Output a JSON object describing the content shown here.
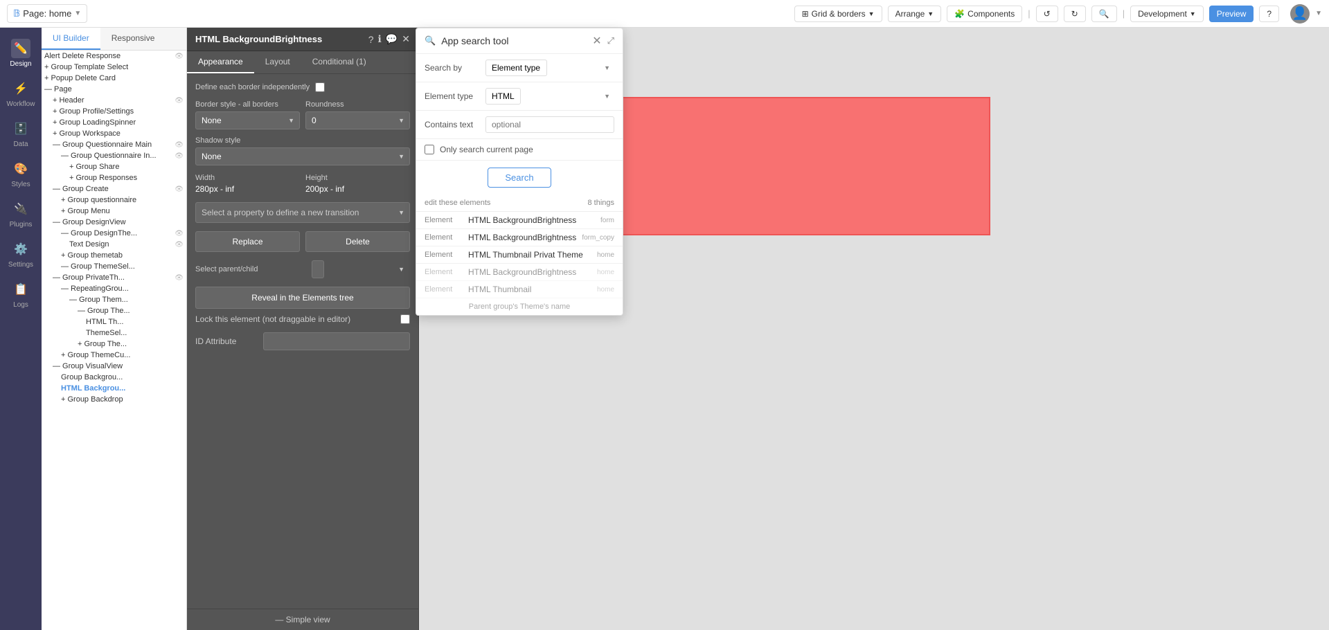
{
  "topbar": {
    "page_label": "Page: home",
    "grid_borders": "Grid & borders",
    "arrange": "Arrange",
    "components": "Components",
    "development": "Development",
    "preview_label": "Preview",
    "help_label": "?"
  },
  "sidebar": {
    "items": [
      {
        "id": "design",
        "label": "Design",
        "icon": "✏️"
      },
      {
        "id": "workflow",
        "label": "Workflow",
        "icon": "⚡"
      },
      {
        "id": "data",
        "label": "Data",
        "icon": "🗄️"
      },
      {
        "id": "styles",
        "label": "Styles",
        "icon": "🎨"
      },
      {
        "id": "plugins",
        "label": "Plugins",
        "icon": "🔌"
      },
      {
        "id": "settings",
        "label": "Settings",
        "icon": "⚙️"
      },
      {
        "id": "logs",
        "label": "Logs",
        "icon": "📋"
      }
    ]
  },
  "elements_panel": {
    "tabs": [
      "UI Builder",
      "Responsive"
    ],
    "tree_items": [
      {
        "label": "Alert Delete Response",
        "indent": 0,
        "has_eye": true
      },
      {
        "label": "+ Group Template Select",
        "indent": 0
      },
      {
        "label": "+ Popup Delete Card",
        "indent": 0
      },
      {
        "label": "— Page",
        "indent": 0
      },
      {
        "label": "+ Header",
        "indent": 1,
        "has_eye": true
      },
      {
        "label": "+ Group Profile/Settings",
        "indent": 1
      },
      {
        "label": "+ Group LoadingSpinner",
        "indent": 1
      },
      {
        "label": "+ Group Workspace",
        "indent": 1
      },
      {
        "label": "— Group Questionnaire Main",
        "indent": 1,
        "has_eye": true
      },
      {
        "label": "— Group Questionnaire In...",
        "indent": 2,
        "has_eye": true
      },
      {
        "label": "+ Group Share",
        "indent": 3
      },
      {
        "label": "+ Group Responses",
        "indent": 3
      },
      {
        "label": "— Group Create",
        "indent": 1,
        "has_eye": true
      },
      {
        "label": "+ Group questionnaire",
        "indent": 2
      },
      {
        "label": "+ Group Menu",
        "indent": 2
      },
      {
        "label": "— Group DesignView",
        "indent": 1
      },
      {
        "label": "— Group DesignThe...",
        "indent": 2,
        "has_eye": true
      },
      {
        "label": "Text Design",
        "indent": 3,
        "has_eye": true
      },
      {
        "label": "+ Group themetab",
        "indent": 2
      },
      {
        "label": "— Group ThemeSel...",
        "indent": 2
      },
      {
        "label": "— Group PrivateTh...",
        "indent": 1,
        "has_eye": true
      },
      {
        "label": "— RepeatingGrou...",
        "indent": 2
      },
      {
        "label": "— Group Them...",
        "indent": 3
      },
      {
        "label": "— Group The...",
        "indent": 4
      },
      {
        "label": "HTML Th...",
        "indent": 5
      },
      {
        "label": "ThemeSel...",
        "indent": 5
      },
      {
        "label": "+ Group The...",
        "indent": 4
      },
      {
        "label": "+ Group ThemeCu...",
        "indent": 2
      },
      {
        "label": "— Group VisualView",
        "indent": 1
      },
      {
        "label": "Group Backgrou...",
        "indent": 2
      },
      {
        "label": "HTML Backgrou...",
        "indent": 2,
        "highlighted": true
      },
      {
        "label": "+ Group Backdrop",
        "indent": 2
      }
    ]
  },
  "prop_panel": {
    "title": "HTML BackgroundBrightness",
    "tabs": [
      "Appearance",
      "Layout",
      "Conditional (1)"
    ],
    "active_tab": "Appearance",
    "define_border_independently_label": "Define each border independently",
    "border_style_label": "Border style - all borders",
    "border_style_value": "None",
    "roundness_label": "Roundness",
    "roundness_value": "0",
    "shadow_style_label": "Shadow style",
    "shadow_style_value": "None",
    "width_label": "Width",
    "width_value": "280px - inf",
    "height_label": "Height",
    "height_value": "200px - inf",
    "transition_placeholder": "Select a property to define a new transition",
    "replace_label": "Replace",
    "delete_label": "Delete",
    "select_parent_child_label": "Select parent/child",
    "reveal_label": "Reveal in the Elements tree",
    "lock_label": "Lock this element (not draggable in editor)",
    "id_attribute_label": "ID Attribute",
    "simple_view_label": "— Simple view"
  },
  "search_modal": {
    "title": "App search tool",
    "search_by_label": "Search by",
    "search_by_value": "Element type",
    "element_type_label": "Element type",
    "element_type_value": "HTML",
    "contains_text_label": "Contains text",
    "contains_text_placeholder": "optional",
    "only_current_page_label": "Only search current page",
    "search_button": "Search",
    "results_header_left": "edit these elements",
    "results_count": "8 things",
    "results": [
      {
        "type": "Element",
        "name": "HTML BackgroundBrightness",
        "page": "form"
      },
      {
        "type": "Element",
        "name": "HTML BackgroundBrightness",
        "page": "form_copy"
      },
      {
        "type": "Element",
        "name": "HTML Thumbnail Privat Theme",
        "page": "home"
      },
      {
        "type": "Element",
        "name": "HTML BackgroundBrightness",
        "page": "home"
      },
      {
        "type": "Element",
        "name": "HTML Thumbnail",
        "page": "home"
      }
    ],
    "more_row": "Parent group's Theme's name"
  },
  "canvas": {
    "red_box_visible": true
  }
}
